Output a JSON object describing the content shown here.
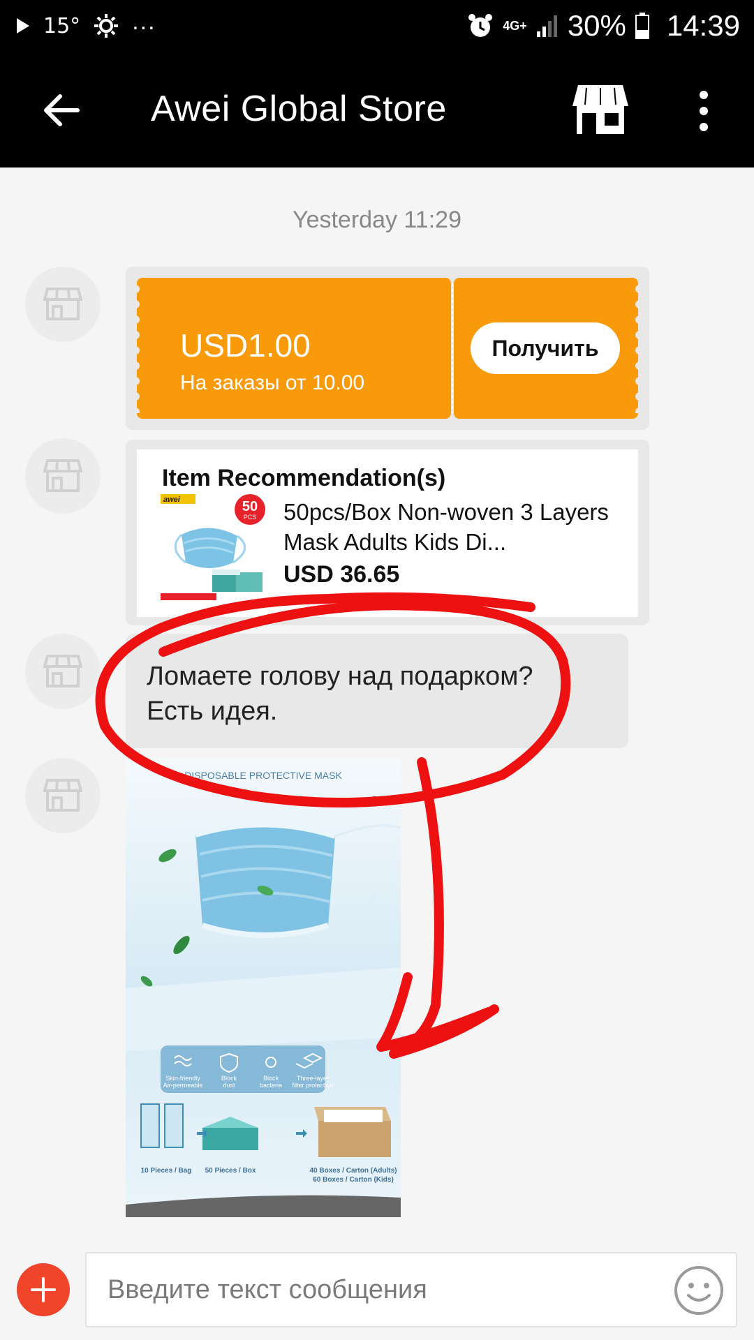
{
  "status_bar": {
    "temperature": "15°",
    "more_dots": "...",
    "network": "4G+",
    "battery_percent": "30%",
    "time": "14:39"
  },
  "app_bar": {
    "title": "Awei Global Store",
    "icons": [
      "back-arrow-icon",
      "store-icon",
      "more-vertical-icon"
    ]
  },
  "chat": {
    "timestamp": "Yesterday 11:29",
    "coupon": {
      "amount": "USD1.00",
      "condition": "На заказы от 10.00",
      "claim_label": "Получить",
      "color": "#f89a09"
    },
    "recommendation": {
      "heading": "Item Recommendation(s)",
      "product_name": "50pcs/Box Non-woven 3 Layers Mask Adults Kids Di...",
      "price": "USD 36.65",
      "thumb_brand": "awei",
      "thumb_badge_top": "50",
      "thumb_badge_bottom": "PCS"
    },
    "message_text_line1": "Ломаете голову над подарком?",
    "message_text_line2": "Есть идея.",
    "image_message": {
      "header": "DISPOSABLE PROTECTIVE MASK",
      "features": [
        {
          "icon": "wave-icon",
          "line1": "Skin-friendly",
          "line2": "Air-permeable"
        },
        {
          "icon": "shield-icon",
          "line1": "Block",
          "line2": "dust"
        },
        {
          "icon": "virus-icon",
          "line1": "Block",
          "line2": "bacteria"
        },
        {
          "icon": "layers-icon",
          "line1": "Three-layer",
          "line2": "filter protection"
        }
      ],
      "packaging": [
        {
          "line1": "10 Pieces / Bag",
          "line2": ""
        },
        {
          "line1": "50 Pieces / Box",
          "line2": ""
        },
        {
          "line1": "40 Boxes / Carton (Adults)",
          "line2": "60 Boxes / Carton (Kids)"
        }
      ]
    }
  },
  "annotation": {
    "color": "#ee1111",
    "description_icon": "red-circle-arrow-annotation"
  },
  "input_bar": {
    "placeholder": "Введите текст сообщения",
    "add_icon": "plus-icon",
    "emoji_icon": "smiley-icon",
    "accent_color": "#f0452b"
  }
}
